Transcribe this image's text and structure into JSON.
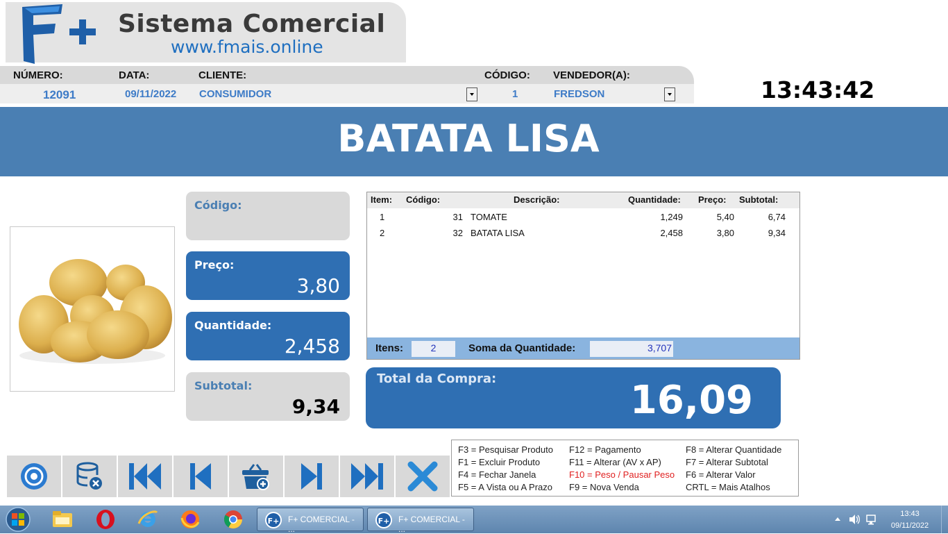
{
  "brand": {
    "title": "Sistema Comercial",
    "url": "www.fmais.online"
  },
  "info": {
    "numero_label": "NÚMERO:",
    "numero": "12091",
    "data_label": "DATA:",
    "data": "09/11/2022",
    "cliente_label": "CLIENTE:",
    "cliente": "CONSUMIDOR",
    "codigo_label": "CÓDIGO:",
    "codigo": "1",
    "vendedor_label": "VENDEDOR(A):",
    "vendedor": "FREDSON"
  },
  "clock": "13:43:42",
  "product_banner": "BATATA LISA",
  "product": {
    "codigo_label": "Código:",
    "codigo": "",
    "preco_label": "Preço:",
    "preco": "3,80",
    "quantidade_label": "Quantidade:",
    "quantidade": "2,458",
    "subtotal_label": "Subtotal:",
    "subtotal": "9,34"
  },
  "table": {
    "headers": {
      "item": "Item:",
      "codigo": "Código:",
      "descricao": "Descrição:",
      "quantidade": "Quantidade:",
      "preco": "Preço:",
      "subtotal": "Subtotal:"
    },
    "rows": [
      {
        "item": "1",
        "codigo": "31",
        "descricao": "TOMATE",
        "quantidade": "1,249",
        "preco": "5,40",
        "subtotal": "6,74"
      },
      {
        "item": "2",
        "codigo": "32",
        "descricao": "BATATA LISA",
        "quantidade": "2,458",
        "preco": "3,80",
        "subtotal": "9,34"
      }
    ],
    "itens_label": "Itens:",
    "itens": "2",
    "soma_label": "Soma da Quantidade:",
    "soma": "3,707"
  },
  "total": {
    "label": "Total da Compra:",
    "value": "16,09"
  },
  "toolbar": [
    "disc-icon",
    "database-delete-icon",
    "first-record-icon",
    "previous-record-icon",
    "basket-add-icon",
    "next-record-icon",
    "last-record-icon",
    "close-icon"
  ],
  "shortcuts": {
    "col1": [
      "F3 = Pesquisar Produto",
      "F1 = Excluir Produto",
      "F4 = Fechar Janela",
      "F5 = A Vista ou A Prazo"
    ],
    "col2": [
      "F12 = Pagamento",
      "F11 = Alterar (AV x AP)",
      "F10 = Peso / Pausar Peso",
      "F9 = Nova Venda"
    ],
    "col3": [
      "F8 = Alterar Quantidade",
      "F7 = Alterar Subtotal",
      "F6 = Alterar Valor",
      "CRTL = Mais Atalhos"
    ]
  },
  "colors": {
    "accent": "#2f6fb3",
    "banner": "#4a7fb3",
    "highlight_shortcut": "#e02020"
  },
  "taskbar": {
    "pinned": [
      "windows-start-icon",
      "file-explorer-icon",
      "opera-icon",
      "internet-explorer-icon",
      "firefox-icon",
      "chrome-icon"
    ],
    "windows": [
      "F+ COMERCIAL - ...",
      "F+ COMERCIAL - ..."
    ],
    "time": "13:43",
    "date": "09/11/2022"
  }
}
